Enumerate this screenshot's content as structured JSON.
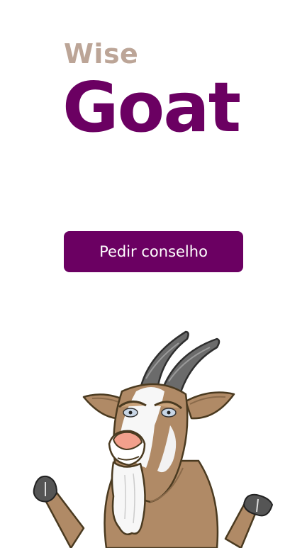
{
  "logo": {
    "small": "Wise",
    "big": "Goat"
  },
  "actions": {
    "ask_advice": "Pedir conselho"
  },
  "illustration": {
    "name": "goat-mascot"
  },
  "colors": {
    "brand": "#6b0062",
    "logo_small": "#bca597",
    "background": "#ffffff"
  }
}
